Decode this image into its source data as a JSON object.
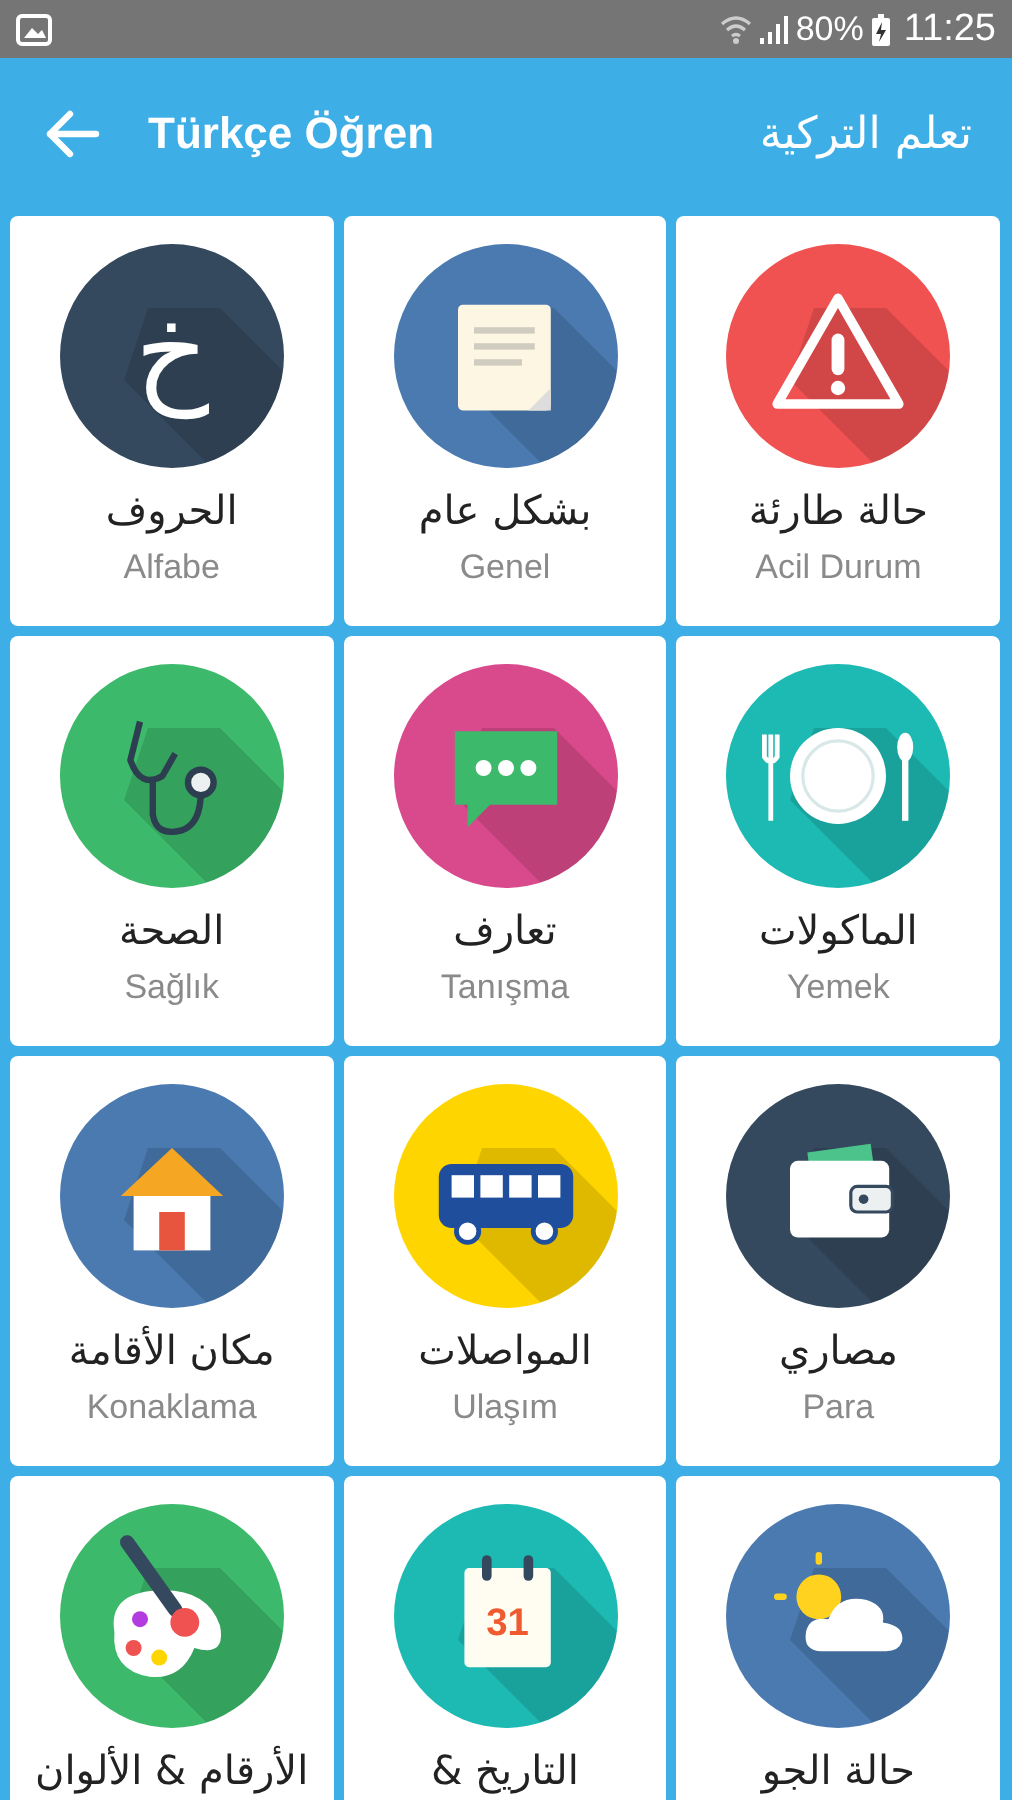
{
  "status_bar": {
    "battery": "80%",
    "time": "11:25"
  },
  "header": {
    "title": "Türkçe Öğren",
    "title_ar": "تعلم التركية"
  },
  "categories": [
    {
      "kind": "warning",
      "color": "#f05151",
      "ar": "حالة طارئة",
      "tr": "Acil Durum"
    },
    {
      "kind": "document",
      "color": "#4a7ab0",
      "ar": "بشكل عام",
      "tr": "Genel"
    },
    {
      "kind": "letter",
      "glyph": "خ",
      "color": "#34495e",
      "ar": "الحروف",
      "tr": "Alfabe"
    },
    {
      "kind": "plate",
      "color": "#1dbab4",
      "ar": "الماكولات",
      "tr": "Yemek"
    },
    {
      "kind": "chat",
      "color": "#d94a8c",
      "ar": "تعارف",
      "tr": "Tanışma"
    },
    {
      "kind": "stethoscope",
      "color": "#3cb96a",
      "ar": "الصحة",
      "tr": "Sağlık"
    },
    {
      "kind": "wallet",
      "color": "#34495e",
      "ar": "مصاري",
      "tr": "Para"
    },
    {
      "kind": "bus",
      "color": "#ffd500",
      "ar": "المواصلات",
      "tr": "Ulaşım"
    },
    {
      "kind": "house",
      "color": "#4a7ab0",
      "ar": "مكان الأقامة",
      "tr": "Konaklama"
    },
    {
      "kind": "weather",
      "color": "#4a7ab0",
      "ar": "حالة الجو"
    },
    {
      "kind": "calendar",
      "date": "31",
      "color": "#1dbab4",
      "ar": "التاريخ &"
    },
    {
      "kind": "palette",
      "color": "#3cb96a",
      "ar": "الأرقام & الألوان"
    }
  ]
}
